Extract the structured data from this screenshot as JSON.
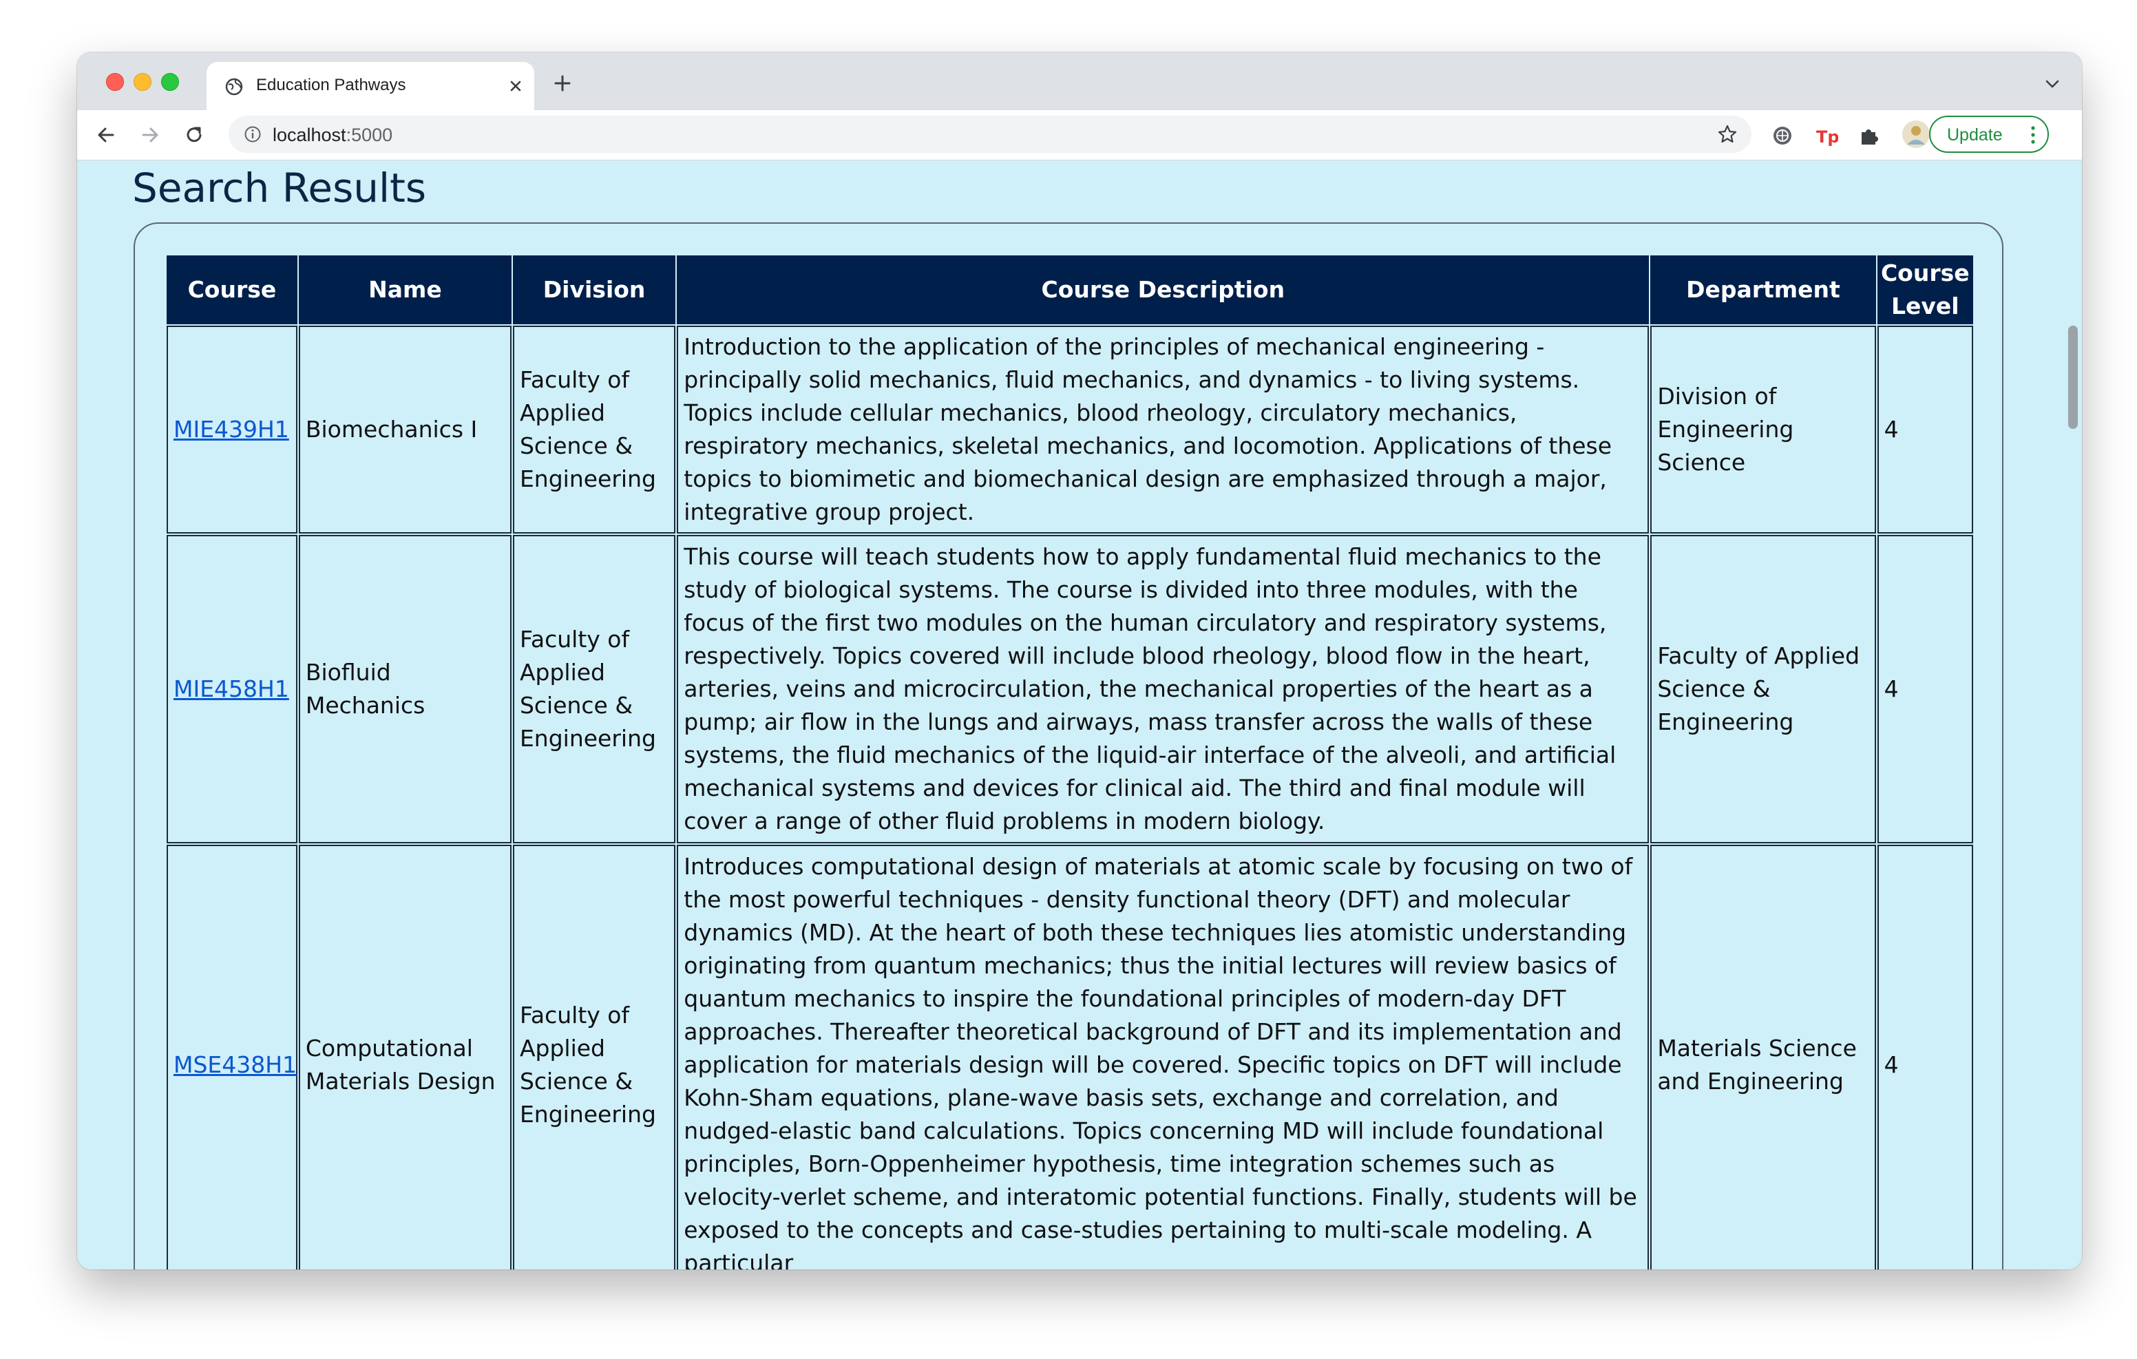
{
  "browser": {
    "tab_title": "Education Pathways",
    "url_host": "localhost",
    "url_port": ":5000",
    "update_label": "Update"
  },
  "page": {
    "heading": "Search Results"
  },
  "table": {
    "headers": [
      "Course",
      "Name",
      "Division",
      "Course Description",
      "Department",
      "Course Level"
    ],
    "rows": [
      {
        "course": "MIE439H1",
        "name": "Biomechanics I",
        "division": "Faculty of Applied Science & Engineering",
        "description": "Introduction to the application of the principles of mechanical engineering - principally solid mechanics, fluid mechanics, and dynamics - to living systems. Topics include cellular mechanics, blood rheology, circulatory mechanics, respiratory mechanics, skeletal mechanics, and locomotion. Applications of these topics to biomimetic and biomechanical design are emphasized through a major, integrative group project.",
        "department": "Division of Engineering Science",
        "level": "4"
      },
      {
        "course": "MIE458H1",
        "name": "Biofluid Mechanics",
        "division": "Faculty of Applied Science & Engineering",
        "description": "This course will teach students how to apply fundamental fluid mechanics to the study of biological systems. The course is divided into three modules, with the focus of the first two modules on the human circulatory and respiratory systems, respectively. Topics covered will include blood rheology, blood flow in the heart, arteries, veins and microcirculation, the mechanical properties of the heart as a pump; air flow in the lungs and airways, mass transfer across the walls of these systems, the fluid mechanics of the liquid-air interface of the alveoli, and artificial mechanical systems and devices for clinical aid. The third and final module will cover a range of other fluid problems in modern biology.",
        "department": "Faculty of Applied Science & Engineering",
        "level": "4"
      },
      {
        "course": "MSE438H1",
        "name": "Computational Materials Design",
        "division": "Faculty of Applied Science & Engineering",
        "description": "Introduces computational design of materials at atomic scale by focusing on two of the most powerful techniques - density functional theory (DFT) and molecular dynamics (MD). At the heart of both these techniques lies atomistic understanding originating from quantum mechanics; thus the initial lectures will review basics of quantum mechanics to inspire the foundational principles of modern-day DFT approaches. Thereafter theoretical background of DFT and its implementation and application for materials design will be covered. Specific topics on DFT will include Kohn-Sham equations, plane-wave basis sets, exchange and correlation, and nudged-elastic band calculations. Topics concerning MD will include foundational principles, Born-Oppenheimer hypothesis, time integration schemes such as velocity-verlet scheme, and interatomic potential functions. Finally, students will be exposed to the concepts and case-studies pertaining to multi-scale modeling. A particular",
        "department": "Materials Science and Engineering",
        "level": "4"
      }
    ]
  }
}
